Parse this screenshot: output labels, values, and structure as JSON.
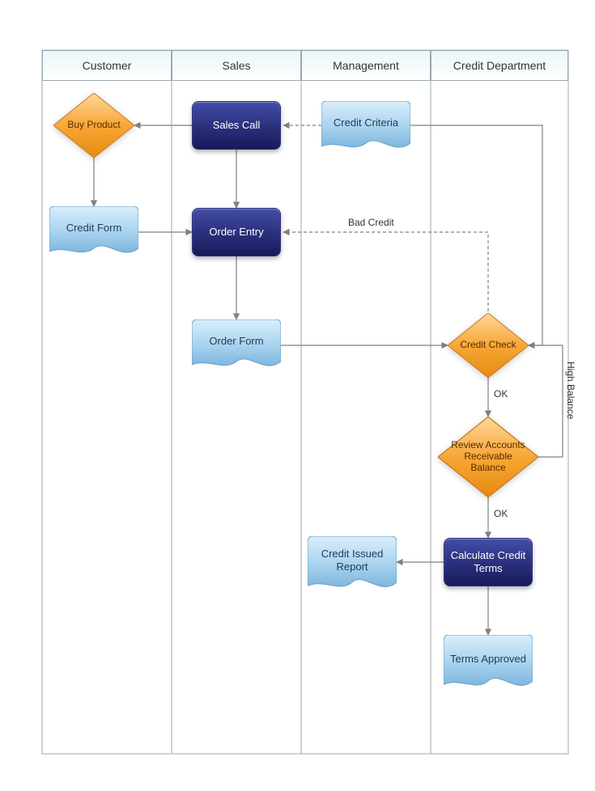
{
  "lanes": {
    "customer": "Customer",
    "sales": "Sales",
    "management": "Management",
    "credit": "Credit Department"
  },
  "nodes": {
    "buy_product": "Buy Product",
    "credit_form": "Credit Form",
    "sales_call": "Sales Call",
    "order_entry": "Order Entry",
    "order_form": "Order Form",
    "credit_criteria": "Credit Criteria",
    "credit_check": "Credit Check",
    "review_ar": "Review Accounts Receivable Balance",
    "calc_terms": "Calculate Credit Terms",
    "credit_issued": "Credit Issued Report",
    "terms_approved": "Terms Approved"
  },
  "edge_labels": {
    "bad_credit": "Bad Credit",
    "ok1": "OK",
    "high_balance": "High Balance",
    "ok2": "OK"
  }
}
